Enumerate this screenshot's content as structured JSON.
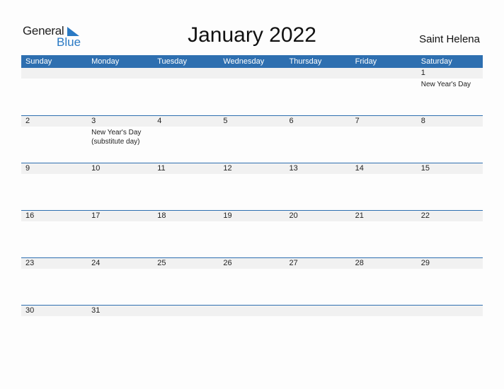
{
  "logo": {
    "general": "General",
    "blue": "Blue"
  },
  "title": "January 2022",
  "country": "Saint Helena",
  "weekdays": [
    "Sunday",
    "Monday",
    "Tuesday",
    "Wednesday",
    "Thursday",
    "Friday",
    "Saturday"
  ],
  "weeks": [
    {
      "days": [
        "",
        "",
        "",
        "",
        "",
        "",
        "1"
      ],
      "events": [
        "",
        "",
        "",
        "",
        "",
        "",
        "New Year's Day"
      ]
    },
    {
      "days": [
        "2",
        "3",
        "4",
        "5",
        "6",
        "7",
        "8"
      ],
      "events": [
        "",
        "New Year's Day (substitute day)",
        "",
        "",
        "",
        "",
        ""
      ]
    },
    {
      "days": [
        "9",
        "10",
        "11",
        "12",
        "13",
        "14",
        "15"
      ],
      "events": [
        "",
        "",
        "",
        "",
        "",
        "",
        ""
      ]
    },
    {
      "days": [
        "16",
        "17",
        "18",
        "19",
        "20",
        "21",
        "22"
      ],
      "events": [
        "",
        "",
        "",
        "",
        "",
        "",
        ""
      ]
    },
    {
      "days": [
        "23",
        "24",
        "25",
        "26",
        "27",
        "28",
        "29"
      ],
      "events": [
        "",
        "",
        "",
        "",
        "",
        "",
        ""
      ]
    },
    {
      "days": [
        "30",
        "31",
        "",
        "",
        "",
        "",
        ""
      ],
      "events": [
        "",
        "",
        "",
        "",
        "",
        "",
        ""
      ]
    }
  ],
  "colors": {
    "accent": "#2e6fb0",
    "row_shade": "#f1f1f1"
  }
}
